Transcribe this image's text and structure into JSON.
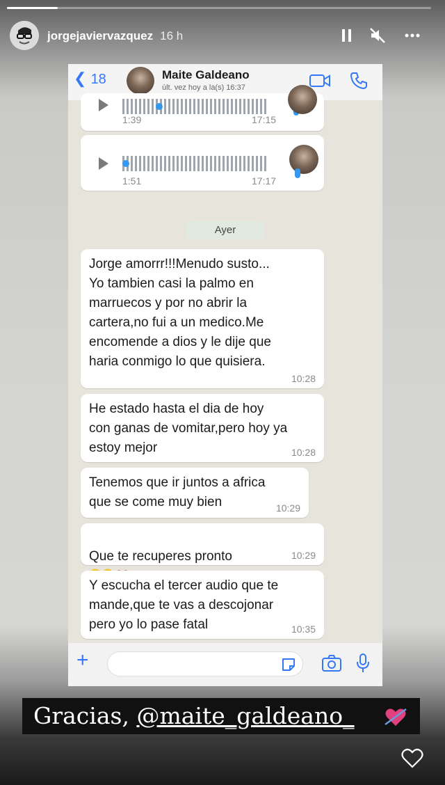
{
  "story": {
    "username": "jorgejaviervazquez",
    "time_ago": "16 h",
    "progress": 0.12
  },
  "chat_header": {
    "back_count": "18",
    "contact_name": "Maite Galdeano",
    "last_seen": "últ. vez hoy a la(s) 16:37"
  },
  "voice_notes": [
    {
      "duration": "1:39",
      "time": "17:15"
    },
    {
      "duration": "1:51",
      "time": "17:17"
    }
  ],
  "day_label": "Ayer",
  "messages": [
    {
      "text": "Jorge amorrr!!!Menudo susto...\nYo tambien casi la  palmo en\nmarruecos y  por no abrir la\ncartera,no fui a un medico.Me\nencomende a dios y le dije que\nharia conmigo lo que quisiera.",
      "time": "10:28"
    },
    {
      "text": "He estado hasta el dia de hoy\ncon ganas de vomitar,pero hoy ya\nestoy mejor",
      "time": "10:28"
    },
    {
      "text": "Tenemos que ir juntos a africa\nque se come muy bien",
      "time": "10:29"
    },
    {
      "text": "Que te recuperes pronto",
      "time": "10:29"
    },
    {
      "text": "Y escucha el tercer audio que te\nmande,que te vas a descojonar\npero yo lo pase fatal",
      "time": "10:35"
    }
  ],
  "caption": {
    "prefix": "Gracias,",
    "mention": "@maite_galdeano_"
  },
  "icons": [
    "pause-icon",
    "muted-speaker-icon",
    "more-icon",
    "video-call-icon",
    "phone-icon",
    "plus-icon",
    "sticker-icon",
    "camera-icon",
    "mic-icon",
    "heart-icon"
  ],
  "colors": {
    "accent": "#3478f6",
    "voice_wave": "#3497f0"
  }
}
